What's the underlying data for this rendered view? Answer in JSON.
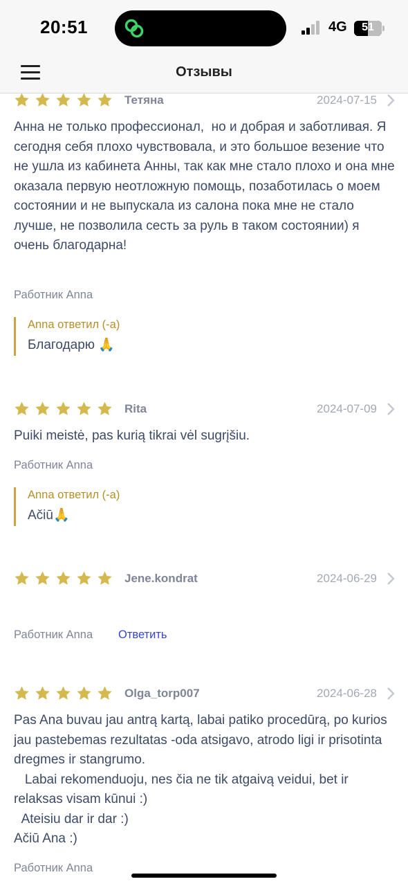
{
  "status_bar": {
    "time": "20:51",
    "network": "4G",
    "battery": "51",
    "battery_level": 0.51,
    "island_icon": "link-rings-icon",
    "island_icon_color": "#3cd36b"
  },
  "nav": {
    "title": "Отзывы",
    "menu_icon": "hamburger-menu-icon"
  },
  "colors": {
    "star": "#d4b94f",
    "reply_border": "#c9a540",
    "reply_author": "#b58f28",
    "link": "#3344dd",
    "text": "#3c4a66",
    "muted": "#7d8597"
  },
  "reviews": [
    {
      "rating": 5,
      "author": "Тетяна",
      "date": "2024-07-15",
      "text": "Анна не только профессионал,  но и добрая и заботливая. Я сегодня себя плохо чувствовала, и это большое везение что не ушла из кабинета Анны, так как мне стало плохо и она мне оказала первую неотложную помощь, позаботилась о моем состоянии и не выпускала из салона пока мне не стало лучше, не позволила сесть за руль в таком состоянии) я очень благодарна!",
      "worker": "Работник Anna",
      "reply": {
        "author": "Anna ответил (-а)",
        "text": "Благодарю 🙏"
      }
    },
    {
      "rating": 5,
      "author": "Rita",
      "date": "2024-07-09",
      "text": "Puiki meistė, pas kurią tikrai vėl sugrįšiu.",
      "worker": "Работник Anna",
      "reply": {
        "author": "Anna ответил (-а)",
        "text": "Ačiū🙏"
      }
    },
    {
      "rating": 5,
      "author": "Jene.kondrat",
      "date": "2024-06-29",
      "text": "",
      "worker": "Работник Anna",
      "reply_button": "Ответить"
    },
    {
      "rating": 5,
      "author": "Olga_torp007",
      "date": "2024-06-28",
      "text": "Pas Ana buvau jau antrą kartą, labai patiko procedūrą, po kurios jau pastebemas rezultatas -oda atsigavo, atrodo ligi ir prisotinta dregmes ir stangrumo.\n   Labai rekomenduoju, nes čia ne tik atgaivą veidui, bet ir relaksas visam kūnui :)\n  Ateisiu dar ir dar :)\nAčiū Ana :)",
      "worker": "Работник Anna"
    }
  ]
}
